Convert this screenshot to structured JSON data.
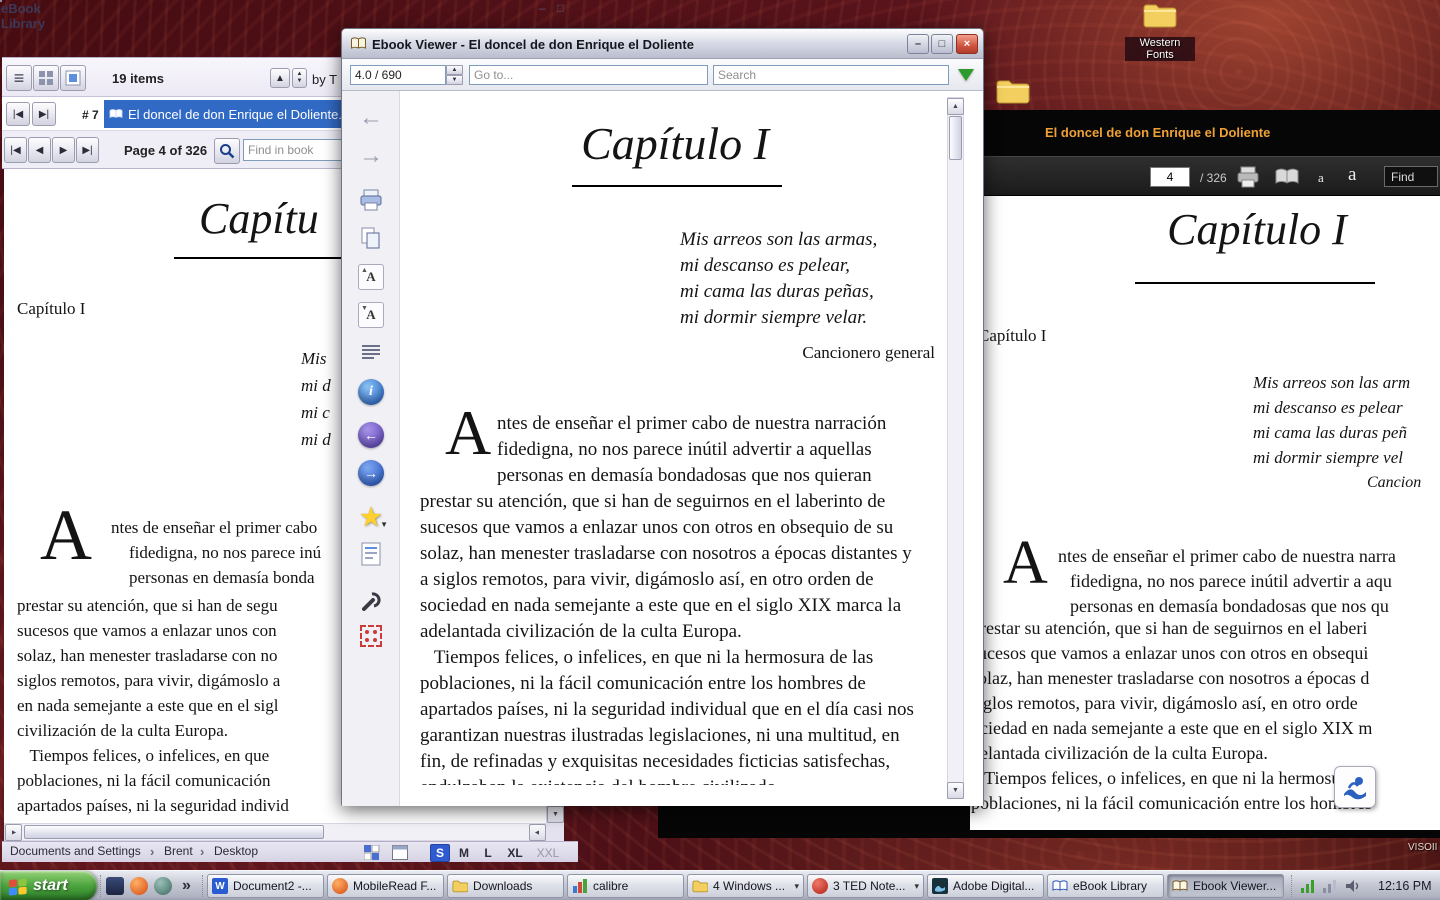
{
  "icons": {
    "window_minimize": "–",
    "window_maximize": "□",
    "window_close": "×",
    "back_arrow": "←",
    "forward_arrow": "→",
    "first": "|◀",
    "prev": "◀",
    "next": "▶",
    "last": "▶|",
    "item_first": "|◀",
    "item_last": "▶|",
    "up_small": "▲",
    "down_small": "▼",
    "list_view": "≡",
    "sort_up": "▲",
    "overflow": "»",
    "crumb_sep": "›",
    "star": "★",
    "info": "i",
    "font_letter": "A",
    "word_glyph": "W",
    "group_arrow": "▾"
  },
  "desktop": {
    "folder_label": "Western Fonts",
    "corner_text": "VISOII"
  },
  "library": {
    "title": "eBook Library",
    "items_count": "19 items",
    "sort_label": "by T",
    "item_index": "# 7",
    "selected_item": "El doncel de don Enrique el Doliente.e",
    "page_label": "Page 4 of 326",
    "find_placeholder": "Find in book",
    "reader": {
      "chapter_title": "Capítu",
      "chapter_heading": "Capítulo I",
      "verse_fragments": [
        "Mis",
        "mi d",
        "mi c",
        "mi d"
      ],
      "dropcap": "A",
      "indent_lines": [
        "ntes de enseñar el primer cabo",
        "fidedigna, no nos parece inú",
        "personas en demasía bonda"
      ],
      "body_lines": [
        "prestar su atención, que si han de segu",
        "sucesos que vamos a enlazar unos con",
        "solaz, han menester trasladarse con no",
        "siglos remotos, para vivir, digámoslo a",
        "en nada semejante a este que en el sigl",
        "civilización de la culta Europa.",
        "   Tiempos felices, o infelices, en que",
        "poblaciones, ni la fácil comunicación",
        "apartados países, ni la seguridad individ"
      ]
    },
    "breadcrumbs": [
      "Documents and Settings",
      "Brent",
      "Desktop"
    ],
    "size_buttons": [
      "S",
      "M",
      "L",
      "XL",
      "XXL"
    ]
  },
  "viewer": {
    "title": "Ebook Viewer - El doncel de don Enrique el Doliente",
    "position_value": "4.0 / 690",
    "goto_placeholder": "Go to...",
    "search_placeholder": "Search",
    "page": {
      "chapter_title": "Capítulo I",
      "verses": [
        "Mis arreos son las armas,",
        "mi descanso es pelear,",
        "mi cama las duras peñas,",
        "mi dormir siempre velar."
      ],
      "attribution": "Cancionero general",
      "dropcap": "A",
      "indent_lines": [
        "ntes de enseñar el primer cabo de nuestra narración",
        "fidedigna, no nos parece inútil advertir a aquellas",
        "personas en demasía bondadosas que nos quieran"
      ],
      "body_lines": [
        "prestar su atención, que si han de seguirnos en el laberinto de",
        "sucesos que vamos a enlazar unos con otros en obsequio de su",
        "solaz, han menester trasladarse con nosotros a épocas distantes y",
        "a siglos remotos, para vivir, digámoslo así, en otro orden de",
        "sociedad en nada semejante a este que en el siglo XIX marca la",
        "adelantada civilización de la culta Europa.",
        "   Tiempos felices, o infelices, en que ni la hermosura de las",
        "poblaciones, ni la fácil comunicación entre los hombres de",
        "apartados países, ni la seguridad individual que en el día casi nos",
        "garantizan nuestras ilustradas legislaciones, ni una multitud, en",
        "fin, de refinadas y exquisitas necesidades ficticias satisfechas,"
      ],
      "partial_line": "endulzaban la existencia del hombre civilizado."
    }
  },
  "ade": {
    "title": "El doncel de don Enrique el Doliente",
    "page_value": "4",
    "page_total": "/ 326",
    "font_small": "a",
    "font_large": "a",
    "find_label": "Find",
    "page": {
      "chapter_title": "Capítulo I",
      "chapter_heading": "Capítulo I",
      "verses": [
        "Mis arreos son las arm",
        "mi descanso es pelear",
        "mi cama las duras peñ",
        "mi dormir siempre vel"
      ],
      "attribution": "Cancion",
      "dropcap": "A",
      "indent_lines": [
        "ntes de enseñar el primer cabo de nuestra narra",
        "fidedigna, no nos parece inútil advertir a aqu",
        "personas en demasía bondadosas que nos qu"
      ],
      "body_lines": [
        "prestar su atención, que si han de seguirnos en el laberi",
        "sucesos que vamos a enlazar unos con otros en obsequi",
        "solaz, han menester trasladarse con nosotros a épocas d",
        "siglos remotos, para vivir, digámoslo así, en otro orde",
        "ociedad en nada semejante a este que en el siglo XIX m",
        "delantada civilización de la culta Europa.",
        "   Tiempos felices, o infelices, en que ni la hermosura d",
        "poblaciones, ni la fácil comunicación entre los hombres"
      ]
    }
  },
  "taskbar": {
    "start_label": "start",
    "buttons": [
      {
        "label": "Document2 -..."
      },
      {
        "label": "MobileRead F..."
      },
      {
        "label": "Downloads"
      },
      {
        "label": "calibre"
      },
      {
        "label": "4 Windows ...",
        "group": true
      },
      {
        "label": "3 TED Note...",
        "group": true
      },
      {
        "label": "Adobe Digital..."
      },
      {
        "label": "eBook Library"
      },
      {
        "label": "Ebook Viewer...",
        "active": true
      }
    ],
    "clock": "12:16 PM"
  }
}
